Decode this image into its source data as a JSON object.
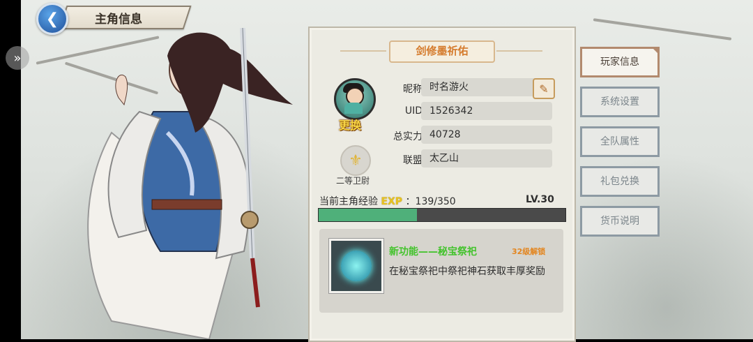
{
  "header": {
    "title": "主角信息",
    "back_icon": "back-arrow-icon"
  },
  "profile": {
    "character_name": "剑修墨祈佑",
    "change_avatar_label": "更换",
    "rank_label": "二等卫尉",
    "rows": [
      {
        "label": "昵称",
        "value": "时名游火"
      },
      {
        "label": "UID",
        "value": "1526342"
      },
      {
        "label": "总实力",
        "value": "40728"
      },
      {
        "label": "联盟",
        "value": "太乙山"
      }
    ],
    "exp_label": "当前主角经验",
    "exp_tag": "EXP",
    "exp_value": "：139/350",
    "level": "LV.30",
    "exp_current": 139,
    "exp_max": 350
  },
  "feature": {
    "title": "新功能——秘宝祭祀",
    "unlock": "32级解锁",
    "desc": "在秘宝祭祀中祭祀神石获取丰厚奖励"
  },
  "tabs": [
    {
      "label": "玩家信息",
      "active": true
    },
    {
      "label": "系统设置",
      "active": false
    },
    {
      "label": "全队属性",
      "active": false
    },
    {
      "label": "礼包兑换",
      "active": false
    },
    {
      "label": "货币说明",
      "active": false
    }
  ],
  "colors": {
    "exp_fill": "#4fb07a",
    "name_color": "#d57b2d",
    "feature_title": "#43c32c"
  }
}
